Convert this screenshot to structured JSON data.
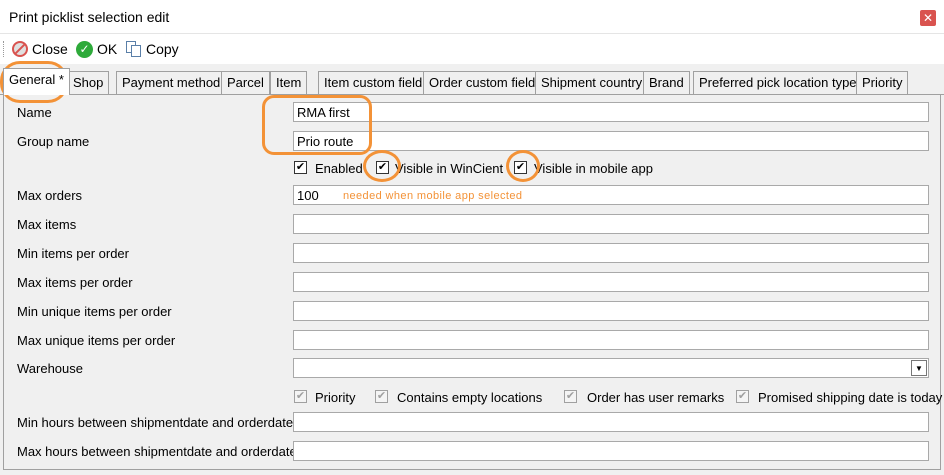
{
  "window": {
    "title": "Print picklist selection edit",
    "close_glyph": "✕"
  },
  "toolbar": {
    "close_label": "Close",
    "ok_label": "OK",
    "copy_label": "Copy"
  },
  "tabs": [
    "General *",
    "Shop",
    "Payment method",
    "Parcel",
    "Item",
    "Item custom field",
    "Order custom field",
    "Shipment country",
    "Brand",
    "Preferred pick location type",
    "Priority"
  ],
  "form": {
    "name_label": "Name",
    "name_value": "RMA first",
    "group_label": "Group name",
    "group_value": "Prio route",
    "enabled_label": "Enabled",
    "wincient_label": "Visible in WinCient",
    "mobile_label": "Visible in mobile app",
    "max_orders_label": "Max orders",
    "max_orders_value": "100",
    "max_items_label": "Max items",
    "min_items_per_order_label": "Min items per order",
    "max_items_per_order_label": "Max items per order",
    "min_unique_label": "Min unique items per order",
    "max_unique_label": "Max unique items per order",
    "warehouse_label": "Warehouse",
    "warehouse_value": "",
    "priority_label": "Priority",
    "empty_locations_label": "Contains empty locations",
    "user_remarks_label": "Order has user remarks",
    "promised_label": "Promised shipping date is today",
    "min_hours_label": "Min hours between shipmentdate and orderdate",
    "max_hours_label": "Max hours between shipmentdate and orderdate"
  },
  "annotation": {
    "note": "needed when mobile app selected"
  },
  "check_glyph": "✔",
  "colors": {
    "highlight": "#f39237",
    "ok_icon": "#2eaa3a",
    "close_icon": "#d9534f"
  }
}
